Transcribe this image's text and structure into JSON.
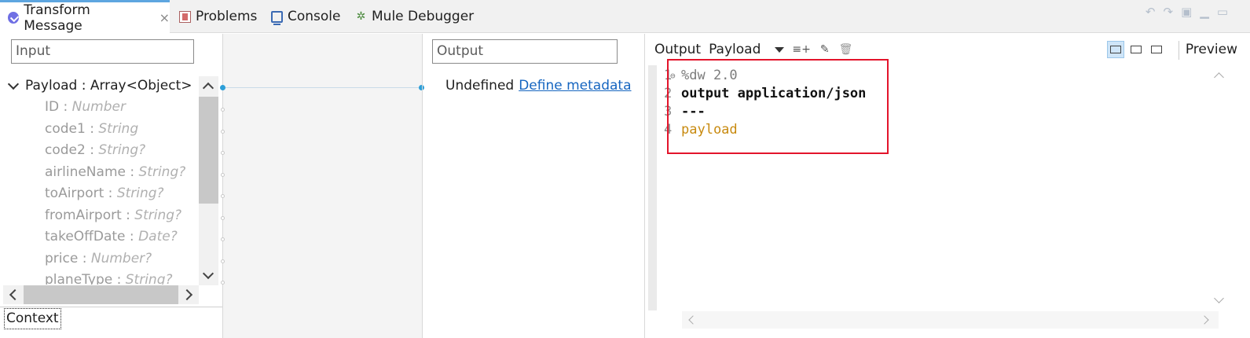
{
  "tabs": [
    {
      "label": "Transform Message",
      "icon": "transform-message-icon",
      "active": true
    },
    {
      "label": "Problems",
      "icon": "problems-icon"
    },
    {
      "label": "Console",
      "icon": "console-icon"
    },
    {
      "label": "Mule Debugger",
      "icon": "debugger-icon"
    }
  ],
  "input": {
    "placeholder": "Input",
    "root": "Payload : Array<Object>",
    "fields": [
      {
        "name": "ID",
        "type": "Number"
      },
      {
        "name": "code1",
        "type": "String"
      },
      {
        "name": "code2",
        "type": "String?"
      },
      {
        "name": "airlineName",
        "type": "String?"
      },
      {
        "name": "toAirport",
        "type": "String?"
      },
      {
        "name": "fromAirport",
        "type": "String?"
      },
      {
        "name": "takeOffDate",
        "type": "Date?"
      },
      {
        "name": "price",
        "type": "Number?"
      },
      {
        "name": "planeType",
        "type": "String?"
      }
    ],
    "context_label": "Context"
  },
  "output": {
    "placeholder": "Output",
    "undefined_text": "Undefined",
    "define_link": "Define metadata"
  },
  "editor": {
    "output_label": "Output",
    "payload_label": "Payload",
    "preview_label": "Preview",
    "code": [
      {
        "num": "1",
        "text": "%dw 2.0",
        "style": "dim"
      },
      {
        "num": "2",
        "text": "output application/json",
        "style": "kw"
      },
      {
        "num": "3",
        "text": "---",
        "style": "kw"
      },
      {
        "num": "4",
        "text": "payload",
        "style": "val"
      }
    ]
  },
  "colors": {
    "active_tab_accent": "#5ea6e0",
    "mapping_dot": "#2d9fd8",
    "highlight_box": "#e3142b",
    "link": "#1565c0",
    "code_value": "#c88a0f"
  }
}
